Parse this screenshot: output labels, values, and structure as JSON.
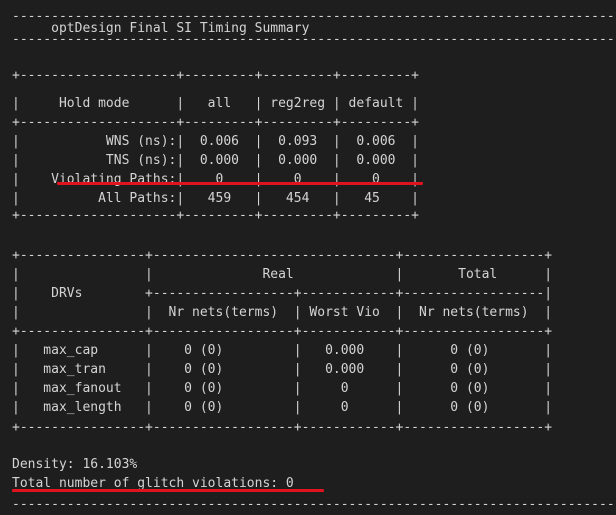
{
  "terminal": {
    "lines": [
      "-----------------------------------------------------------------------------------",
      "     optDesign Final SI Timing Summary",
      "-----------------------------------------------------------------------------------",
      "",
      "+--------------------+---------+---------+---------+",
      "|     Hold mode      |   all   | reg2reg | default |",
      "+--------------------+---------+---------+---------+",
      "|           WNS (ns):|  0.006  |  0.093  |  0.006  |",
      "|           TNS (ns):|  0.000  |  0.000  |  0.000  |",
      "|    Violating Paths:|    0    |    0    |    0    |",
      "|          All Paths:|   459   |   454   |   45    |",
      "+--------------------+---------+---------+---------+",
      "",
      "+----------------+-------------------------------+------------------+",
      "|                |              Real             |       Total      |",
      "|    DRVs        +------------------+------------+------------------|",
      "|                |  Nr nets(terms)  | Worst Vio  |  Nr nets(terms)  |",
      "+----------------+------------------+------------+------------------+",
      "|   max_cap      |    0 (0)         |   0.000    |      0 (0)       |",
      "|   max_tran     |    0 (0)         |   0.000    |      0 (0)       |",
      "|   max_fanout   |    0 (0)         |     0      |      0 (0)       |",
      "|   max_length   |    0 (0)         |     0      |      0 (0)       |",
      "+----------------+------------------+------------+------------------+",
      "",
      "Density: 16.103%",
      "Total number of glitch violations: 0",
      "-----------------------------------------------------------------------------------"
    ]
  },
  "highlight_color": "#e0141e"
}
